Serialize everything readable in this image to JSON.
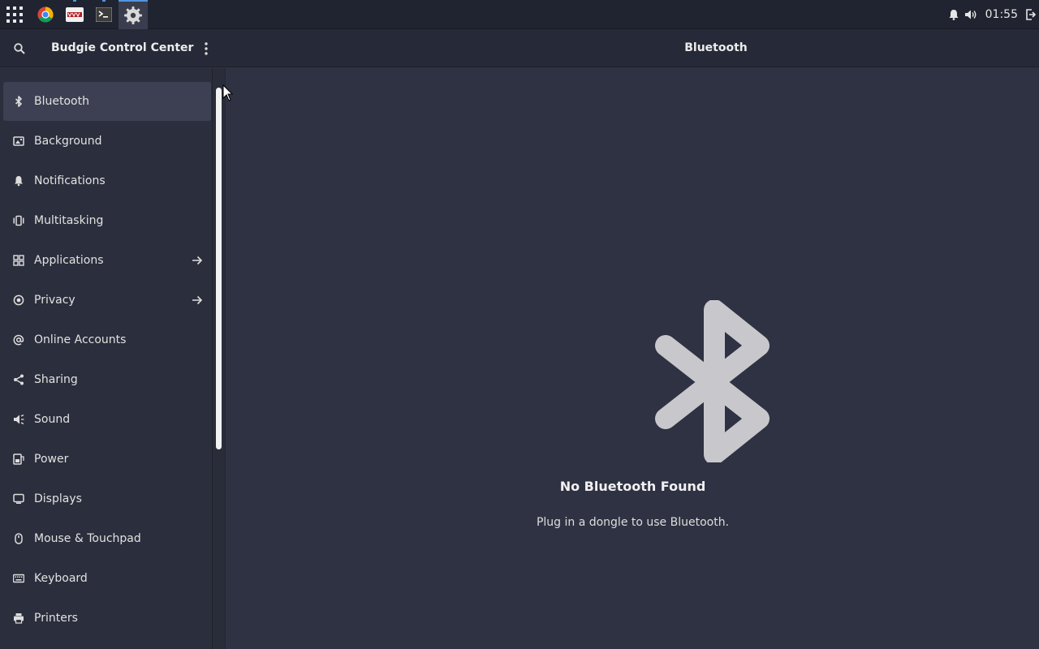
{
  "taskbar": {
    "launchers": [
      {
        "icon": "chrome-icon"
      },
      {
        "icon": "vnc-viewer-icon"
      },
      {
        "icon": "terminal-icon"
      },
      {
        "icon": "settings-gear-icon",
        "active": true
      }
    ],
    "tray": {
      "clock": "01:55",
      "icons": [
        "notification-bell-icon",
        "volume-icon",
        "logout-icon"
      ]
    }
  },
  "header": {
    "app_title": "Budgie Control Center",
    "page_title": "Bluetooth"
  },
  "sidebar": {
    "items": [
      {
        "label": "Bluetooth",
        "icon": "bluetooth-icon",
        "active": true
      },
      {
        "label": "Background",
        "icon": "background-icon"
      },
      {
        "label": "Notifications",
        "icon": "bell-icon"
      },
      {
        "label": "Multitasking",
        "icon": "multitasking-icon"
      },
      {
        "label": "Applications",
        "icon": "applications-icon",
        "arrow": true
      },
      {
        "label": "Privacy",
        "icon": "privacy-icon",
        "arrow": true
      },
      {
        "label": "Online Accounts",
        "icon": "at-icon"
      },
      {
        "label": "Sharing",
        "icon": "share-icon"
      },
      {
        "label": "Sound",
        "icon": "speaker-icon"
      },
      {
        "label": "Power",
        "icon": "power-icon"
      },
      {
        "label": "Displays",
        "icon": "display-icon"
      },
      {
        "label": "Mouse & Touchpad",
        "icon": "mouse-icon"
      },
      {
        "label": "Keyboard",
        "icon": "keyboard-icon"
      },
      {
        "label": "Printers",
        "icon": "printer-icon"
      }
    ]
  },
  "main": {
    "status_icon": "bluetooth-large-icon",
    "status_title": "No Bluetooth Found",
    "status_subtitle": "Plug in a dongle to use Bluetooth."
  },
  "colors": {
    "taskbar_bg": "#202330",
    "headerbar_bg": "#262937",
    "sidebar_bg": "#2b2e3c",
    "main_bg": "#2f3242",
    "accent": "#5294e2",
    "icon_gray": "#c8c8cc"
  }
}
